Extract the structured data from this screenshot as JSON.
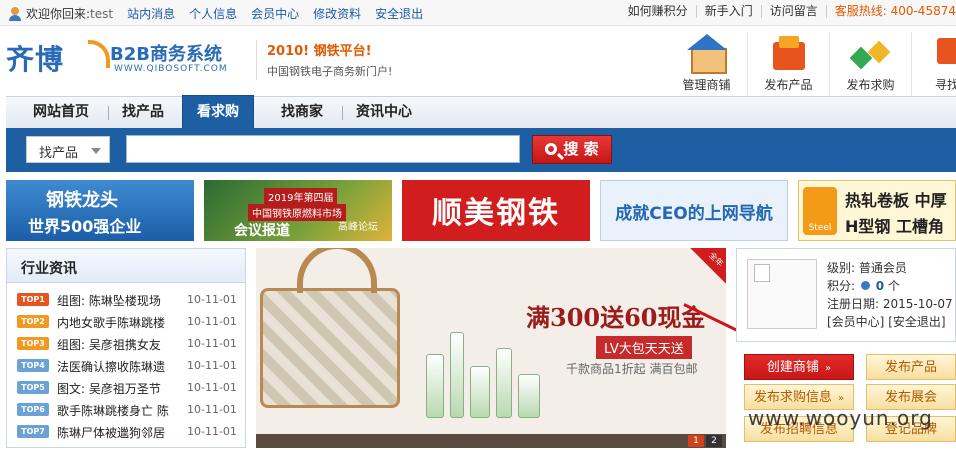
{
  "topbar": {
    "welcome": "欢迎你回来:",
    "username": "test",
    "links": [
      "站内消息",
      "个人信息",
      "会员中心",
      "修改资料",
      "安全退出"
    ],
    "right_links": [
      "如何赚积分",
      "新手入门",
      "访问留言"
    ],
    "hotline": "客服热线: 400-45874"
  },
  "header": {
    "logo_cn": "齐博",
    "logo_b2b": "B2B商务系统",
    "logo_url": "WWW.QIBOSOFT.COM",
    "slogan_1": "2010! 钢铁平台!",
    "slogan_2": "中国钢铁电子商务新门户!",
    "icons": [
      {
        "label": "管理商铺",
        "icon": "shop-icon"
      },
      {
        "label": "发布产品",
        "icon": "product-icon"
      },
      {
        "label": "发布求购",
        "icon": "purchase-icon"
      },
      {
        "label": "寻找商",
        "icon": "find-icon"
      }
    ]
  },
  "nav": {
    "items": [
      "网站首页",
      "找产品",
      "看求购",
      "找商家",
      "资讯中心"
    ],
    "active": "看求购"
  },
  "search": {
    "category": "找产品",
    "query": "",
    "button": "搜 索"
  },
  "banners": {
    "b1_line1": "钢铁龙头",
    "b1_line2": "世界500强企业",
    "b2_line1": "2019年第四届",
    "b2_line2": "中国钢铁原燃料市场",
    "b2_line3": "会议报道",
    "b2_line4": "高峰论坛",
    "b3": "顺美钢铁",
    "b4": "成就CEO的上网导航",
    "b5_line1": "热轧卷板 中厚",
    "b5_line2": "H型钢 工槽角",
    "b5_logo": "Steel"
  },
  "news": {
    "title": "行业资讯",
    "items": [
      {
        "rank": "TOP1",
        "title": "组图: 陈琳坠楼现场",
        "date": "10-11-01"
      },
      {
        "rank": "TOP2",
        "title": "内地女歌手陈琳跳楼",
        "date": "10-11-01"
      },
      {
        "rank": "TOP3",
        "title": "组图: 吴彦祖携女友",
        "date": "10-11-01"
      },
      {
        "rank": "TOP4",
        "title": "法医确认擦收陈琳遗",
        "date": "10-11-01"
      },
      {
        "rank": "TOP5",
        "title": "图文: 吴彦祖万圣节",
        "date": "10-11-01"
      },
      {
        "rank": "TOP6",
        "title": "歌手陈琳跳楼身亡 陈",
        "date": "10-11-01"
      },
      {
        "rank": "TOP7",
        "title": "陈琳尸体被邋狗邻居",
        "date": "10-11-01"
      }
    ]
  },
  "promo": {
    "headline": "满300送60现金",
    "tag": "LV大包天天送",
    "sub": "千款商品1折起 满百包邮",
    "corner": "全年",
    "pages": [
      "1",
      "2"
    ]
  },
  "member": {
    "level_label": "级别:",
    "level": "普通会员",
    "points_label": "积分:",
    "points": "0",
    "points_unit": "个",
    "reg_label": "注册日期:",
    "reg_date": "2015-10-07",
    "center_link": "[会员中心]",
    "logout_link": "[安全退出]"
  },
  "actions": {
    "create_shop": "创建商铺",
    "post_product": "发布产品",
    "post_purchase": "发布求购信息",
    "post_expo": "发布展会",
    "post_recruit": "发布招聘信息",
    "login_brand": "登记品牌"
  },
  "watermark": "www.wooyun.org",
  "colors": {
    "brand_blue": "#1e5fa3",
    "accent_red": "#d11d1d",
    "accent_orange": "#e25a00"
  }
}
